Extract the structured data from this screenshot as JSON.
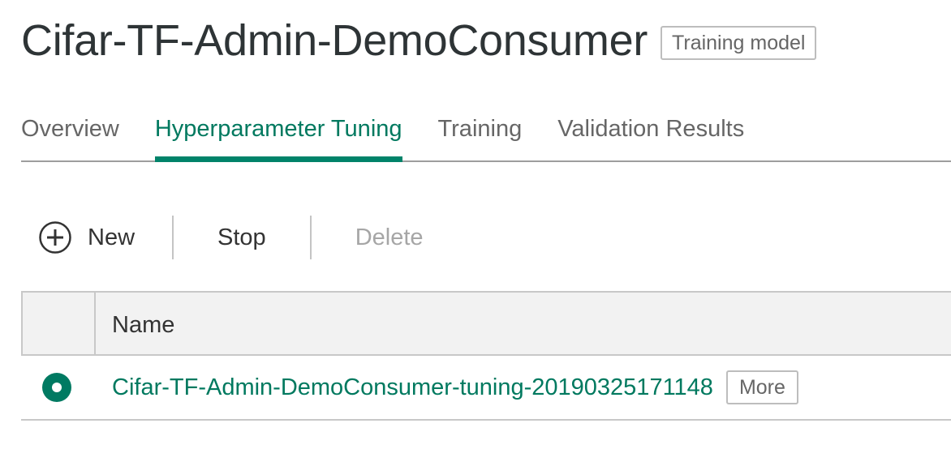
{
  "header": {
    "title": "Cifar-TF-Admin-DemoConsumer",
    "status_tag": "Training model"
  },
  "tabs": [
    {
      "label": "Overview",
      "active": false
    },
    {
      "label": "Hyperparameter Tuning",
      "active": true
    },
    {
      "label": "Training",
      "active": false
    },
    {
      "label": "Validation Results",
      "active": false
    }
  ],
  "toolbar": {
    "new_label": "New",
    "stop_label": "Stop",
    "delete_label": "Delete"
  },
  "table": {
    "columns": [
      "Name"
    ],
    "rows": [
      {
        "name": "Cifar-TF-Admin-DemoConsumer-tuning-20190325171148",
        "more_label": "More",
        "selected": true
      }
    ]
  },
  "colors": {
    "accent": "#00795f",
    "accent_bar": "#00836a",
    "disabled_text": "#a6a6a6"
  },
  "icons": {
    "new": "plus-circle-icon",
    "row_select": "radio-selected-icon"
  }
}
